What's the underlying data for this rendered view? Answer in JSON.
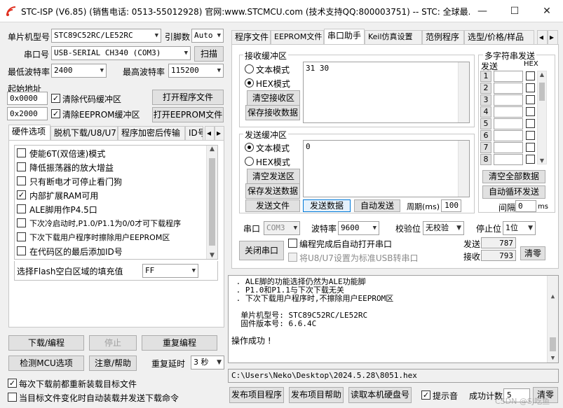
{
  "window": {
    "title": "STC-ISP (V6.85) (销售电话: 0513-55012928) 官网:www.STCMCU.com  (技术支持QQ:800003751)  -- STC: 全球最...",
    "minimize": "—",
    "maximize": "☐",
    "close": "✕"
  },
  "left": {
    "mcu_label": "单片机型号",
    "mcu_value": "STC89C52RC/LE52RC",
    "pin_label": "引脚数",
    "pin_value": "Auto",
    "port_label": "串口号",
    "port_value": "USB-SERIAL CH340 (COM3)",
    "scan_button": "扫描",
    "min_baud_label": "最低波特率",
    "min_baud_value": "2400",
    "max_baud_label": "最高波特率",
    "max_baud_value": "115200",
    "start_addr_label": "起始地址",
    "addr1": "0x0000",
    "clear_code_label": "清除代码缓冲区",
    "clear_code_checked": true,
    "open_program_button": "打开程序文件",
    "addr2": "0x2000",
    "clear_eeprom_label": "清除EEPROM缓冲区",
    "clear_eeprom_checked": true,
    "open_eeprom_button": "打开EEPROM文件",
    "tabs": [
      "硬件选项",
      "脱机下载/U8/U7",
      "程序加密后传输",
      "ID号"
    ],
    "options": [
      {
        "label": "使能6T(双倍速)模式",
        "checked": false
      },
      {
        "label": "降低振荡器的放大增益",
        "checked": false
      },
      {
        "label": "只有断电才可停止看门狗",
        "checked": false
      },
      {
        "label": "内部扩展RAM可用",
        "checked": true
      },
      {
        "label": "ALE脚用作P4.5口",
        "checked": false
      },
      {
        "label": "下次冷启动时,P1.0/P1.1为0/0才可下载程序",
        "checked": false
      },
      {
        "label": "下次下载用户程序时擦除用户EEPROM区",
        "checked": false
      },
      {
        "label": "在代码区的最后添加ID号",
        "checked": false
      }
    ],
    "fill_label": "选择Flash空白区域的填充值",
    "fill_value": "FF",
    "download_button": "下载/编程",
    "stop_button": "停止",
    "reprogram_button": "重复编程",
    "check_mcu_button": "检测MCU选项",
    "help_button": "注意/帮助",
    "repeat_delay_label": "重复延时",
    "repeat_delay_value": "3 秒",
    "reload_label": "每次下载前都重新装载目标文件",
    "reload_checked": true,
    "auto_load_label": "当目标文件变化时自动装载并发送下载命令",
    "auto_load_checked": false
  },
  "right": {
    "tabs": [
      "程序文件",
      "EEPROM文件",
      "串口助手",
      "Keil仿真设置",
      "范例程序",
      "选型/价格/样品"
    ],
    "receive": {
      "group_label": "接收缓冲区",
      "text_mode": "文本模式",
      "hex_mode": "HEX模式",
      "clear_button": "清空接收区",
      "save_button": "保存接收数据",
      "content": "31 30"
    },
    "send": {
      "group_label": "发送缓冲区",
      "text_mode": "文本模式",
      "hex_mode": "HEX模式",
      "clear_button": "清空发送区",
      "save_button": "保存发送数据",
      "content": "0",
      "send_file_button": "发送文件",
      "send_data_button": "发送数据",
      "auto_send_button": "自动发送",
      "period_label": "周期(ms)",
      "period_value": "100"
    },
    "multi": {
      "title": "多字符串发送",
      "send_header": "发送",
      "hex_header": "HEX",
      "rows": [
        "1",
        "2",
        "3",
        "4",
        "5",
        "6",
        "7",
        "8"
      ],
      "clear_all_button": "清空全部数据",
      "auto_loop_button": "自动循环发送",
      "interval_label": "间隔",
      "interval_value": "0",
      "interval_unit": "ms"
    },
    "serial": {
      "port_label": "串口",
      "port_value": "COM3",
      "baud_label": "波特率",
      "baud_value": "9600",
      "parity_label": "校验位",
      "parity_value": "无校验",
      "stop_label": "停止位",
      "stop_value": "1位",
      "close_button": "关闭串口",
      "open_after_label": "编程完成后自动打开串口",
      "u8_label": "将U8/U7设置为标准USB转串口",
      "sent_label": "发送",
      "sent_value": "787",
      "recv_label": "接收",
      "recv_value": "793",
      "clear_button": "清零"
    },
    "log": [
      " . ALE脚的功能选择仍然为ALE功能脚",
      " . P1.0和P1.1与下次下载无关",
      " . 下次下载用户程序时,不擦除用户EEPROM区",
      "",
      "  单片机型号: STC89C52RC/LE52RC",
      "  固件版本号: 6.6.4C",
      "",
      "操作成功 !"
    ],
    "path": "C:\\Users\\Neko\\Desktop\\2024.5.28\\8051.hex",
    "publish_program": "发布项目程序",
    "publish_help": "发布项目帮助",
    "read_disk": "读取本机硬盘号",
    "sound_label": "提示音",
    "sound_checked": true,
    "success_label": "成功计数",
    "success_value": "5",
    "clear_button": "清零",
    "watermark": "CSDN @SJ吃鱼"
  }
}
